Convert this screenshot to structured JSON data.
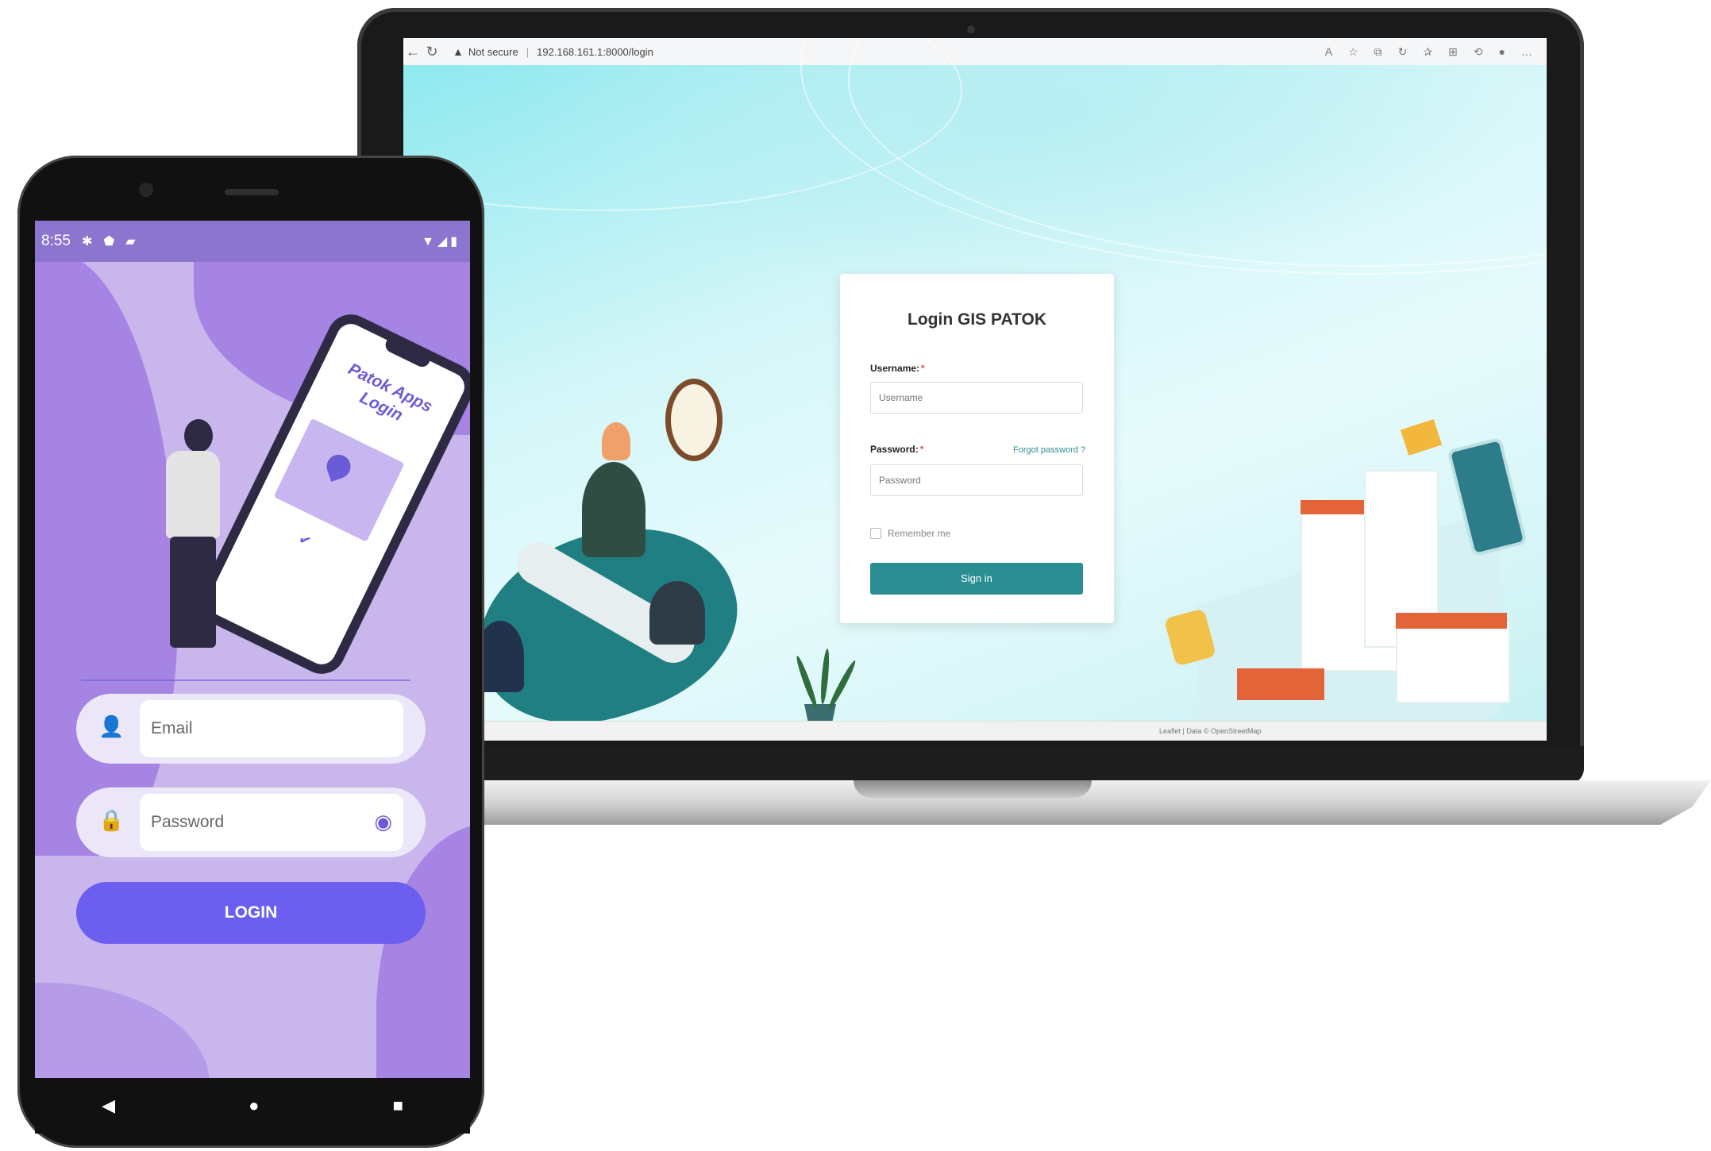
{
  "browser": {
    "back_icon": "arrow-left-icon",
    "reload_icon": "reload-icon",
    "security_text": "Not secure",
    "url": "192.168.161.1:8000/login"
  },
  "web_login": {
    "title": "Login GIS PATOK",
    "username_label": "Username:",
    "username_placeholder": "Username",
    "password_label": "Password:",
    "password_placeholder": "Password",
    "forgot_password": "Forgot password ?",
    "remember_me": "Remember me",
    "signin_label": "Sign in",
    "accent_color": "#2b8e92"
  },
  "web_footer": {
    "attribution": "Leaflet | Data © OpenStreetMap"
  },
  "phone": {
    "status_time": "8:55",
    "illustration_text": "Patok Apps Login",
    "email_placeholder": "Email",
    "password_placeholder": "Password",
    "login_label": "LOGIN",
    "accent_color": "#6c5ff0",
    "background_color": "#c9b6ec"
  }
}
